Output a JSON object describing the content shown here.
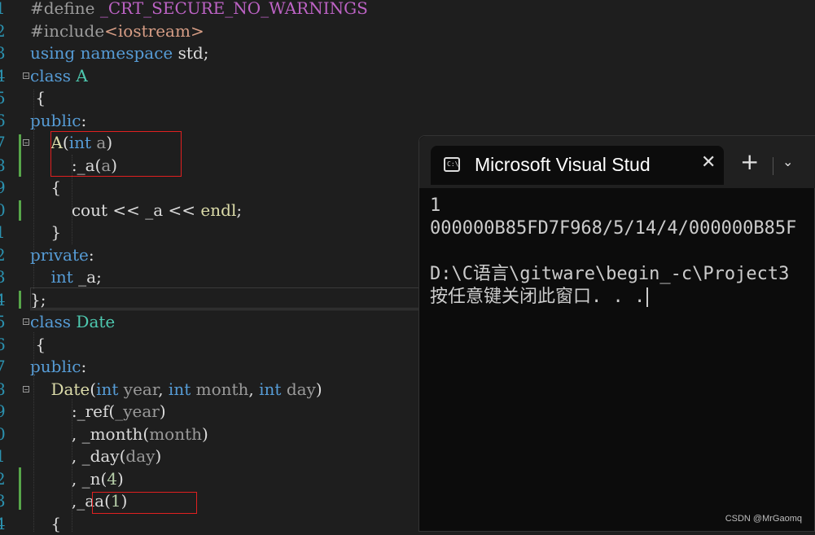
{
  "editor": {
    "line_numbers": [
      "1",
      "2",
      "3",
      "4",
      "5",
      "6",
      "7",
      "8",
      "9",
      "0",
      "1",
      "2",
      "3",
      "4",
      "5",
      "6",
      "7",
      "8",
      "9",
      "0",
      "1",
      "2",
      "3",
      "4"
    ],
    "lines": [
      {
        "parts": [
          {
            "c": "pp",
            "t": "#define "
          },
          {
            "c": "macro",
            "t": "_CRT_SECURE_NO_WARNINGS"
          }
        ]
      },
      {
        "parts": [
          {
            "c": "pp",
            "t": "#include"
          },
          {
            "c": "inc",
            "t": "<iostream>"
          }
        ]
      },
      {
        "parts": [
          {
            "c": "kw",
            "t": "using"
          },
          {
            "c": "",
            "t": " "
          },
          {
            "c": "kw",
            "t": "namespace"
          },
          {
            "c": "",
            "t": " std;"
          }
        ]
      },
      {
        "parts": [
          {
            "c": "kw",
            "t": "class"
          },
          {
            "c": "",
            "t": " "
          },
          {
            "c": "type",
            "t": "A"
          }
        ]
      },
      {
        "parts": [
          {
            "c": "",
            "t": " {"
          }
        ]
      },
      {
        "parts": [
          {
            "c": "kw",
            "t": "public"
          },
          {
            "c": "",
            "t": ":"
          }
        ]
      },
      {
        "parts": [
          {
            "c": "",
            "t": "    "
          },
          {
            "c": "fn",
            "t": "A"
          },
          {
            "c": "",
            "t": "("
          },
          {
            "c": "kw",
            "t": "int"
          },
          {
            "c": "",
            "t": " "
          },
          {
            "c": "param",
            "t": "a"
          },
          {
            "c": "",
            "t": ")"
          }
        ]
      },
      {
        "parts": [
          {
            "c": "",
            "t": "        :"
          },
          {
            "c": "mem",
            "t": "_a"
          },
          {
            "c": "",
            "t": "("
          },
          {
            "c": "param",
            "t": "a"
          },
          {
            "c": "",
            "t": ")"
          }
        ]
      },
      {
        "parts": [
          {
            "c": "",
            "t": "    {"
          }
        ]
      },
      {
        "parts": [
          {
            "c": "",
            "t": "        cout << "
          },
          {
            "c": "mem",
            "t": "_a"
          },
          {
            "c": "",
            "t": " << "
          },
          {
            "c": "fn",
            "t": "endl"
          },
          {
            "c": "",
            "t": ";"
          }
        ]
      },
      {
        "parts": [
          {
            "c": "",
            "t": "    }"
          }
        ]
      },
      {
        "parts": [
          {
            "c": "kw",
            "t": "private"
          },
          {
            "c": "",
            "t": ":"
          }
        ]
      },
      {
        "parts": [
          {
            "c": "",
            "t": "    "
          },
          {
            "c": "kw",
            "t": "int"
          },
          {
            "c": "",
            "t": " "
          },
          {
            "c": "mem",
            "t": "_a"
          },
          {
            "c": "",
            "t": ";"
          }
        ]
      },
      {
        "parts": [
          {
            "c": "",
            "t": "};"
          }
        ]
      },
      {
        "parts": [
          {
            "c": "kw",
            "t": "class"
          },
          {
            "c": "",
            "t": " "
          },
          {
            "c": "type",
            "t": "Date"
          }
        ]
      },
      {
        "parts": [
          {
            "c": "",
            "t": " {"
          }
        ]
      },
      {
        "parts": [
          {
            "c": "kw",
            "t": "public"
          },
          {
            "c": "",
            "t": ":"
          }
        ]
      },
      {
        "parts": [
          {
            "c": "",
            "t": "    "
          },
          {
            "c": "fn",
            "t": "Date"
          },
          {
            "c": "",
            "t": "("
          },
          {
            "c": "kw",
            "t": "int"
          },
          {
            "c": "",
            "t": " "
          },
          {
            "c": "param",
            "t": "year"
          },
          {
            "c": "",
            "t": ", "
          },
          {
            "c": "kw",
            "t": "int"
          },
          {
            "c": "",
            "t": " "
          },
          {
            "c": "param",
            "t": "month"
          },
          {
            "c": "",
            "t": ", "
          },
          {
            "c": "kw",
            "t": "int"
          },
          {
            "c": "",
            "t": " "
          },
          {
            "c": "param",
            "t": "day"
          },
          {
            "c": "",
            "t": ")"
          }
        ]
      },
      {
        "parts": [
          {
            "c": "",
            "t": "        :"
          },
          {
            "c": "mem",
            "t": "_ref"
          },
          {
            "c": "",
            "t": "("
          },
          {
            "c": "param",
            "t": "_year"
          },
          {
            "c": "",
            "t": ")"
          }
        ]
      },
      {
        "parts": [
          {
            "c": "",
            "t": "        , "
          },
          {
            "c": "mem",
            "t": "_month"
          },
          {
            "c": "",
            "t": "("
          },
          {
            "c": "param",
            "t": "month"
          },
          {
            "c": "",
            "t": ")"
          }
        ]
      },
      {
        "parts": [
          {
            "c": "",
            "t": "        , "
          },
          {
            "c": "mem",
            "t": "_day"
          },
          {
            "c": "",
            "t": "("
          },
          {
            "c": "param",
            "t": "day"
          },
          {
            "c": "",
            "t": ")"
          }
        ]
      },
      {
        "parts": [
          {
            "c": "",
            "t": "        , "
          },
          {
            "c": "mem",
            "t": "_n"
          },
          {
            "c": "",
            "t": "("
          },
          {
            "c": "num",
            "t": "4"
          },
          {
            "c": "",
            "t": ")"
          }
        ]
      },
      {
        "parts": [
          {
            "c": "",
            "t": "        ,"
          },
          {
            "c": "mem",
            "t": "_aa"
          },
          {
            "c": "",
            "t": "("
          },
          {
            "c": "num",
            "t": "1"
          },
          {
            "c": "",
            "t": ")"
          }
        ]
      },
      {
        "parts": [
          {
            "c": "",
            "t": "    {"
          }
        ]
      }
    ]
  },
  "terminal": {
    "tab_title": "Microsoft Visual Stud",
    "tab_icon": "console-icon",
    "close_glyph": "✕",
    "new_tab_glyph": "+",
    "dropdown_glyph": "⌄",
    "output": [
      "1",
      "000000B85FD7F968/5/14/4/000000B85F",
      "",
      "D:\\C语言\\gitware\\begin_-c\\Project3",
      "按任意键关闭此窗口. . ."
    ]
  },
  "watermark": "CSDN @MrGaomq"
}
